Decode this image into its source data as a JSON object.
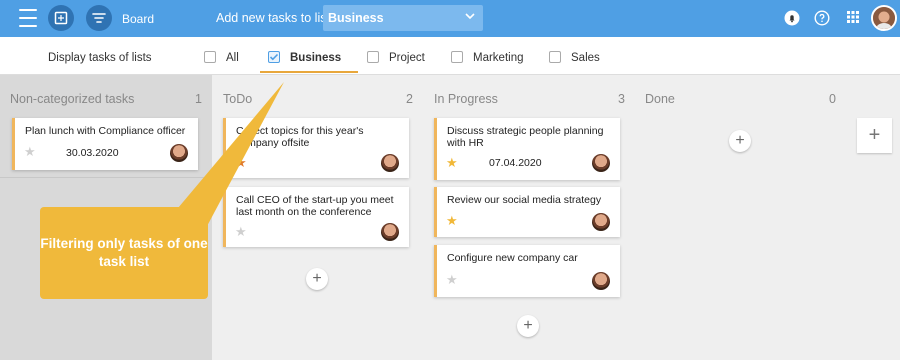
{
  "header": {
    "board_label": "Board",
    "add_label": "Add new tasks to list",
    "list_select_value": "Business"
  },
  "filter": {
    "label": "Display tasks of lists",
    "options": [
      {
        "label": "All",
        "checked": false
      },
      {
        "label": "Business",
        "checked": true
      },
      {
        "label": "Project",
        "checked": false
      },
      {
        "label": "Marketing",
        "checked": false
      },
      {
        "label": "Sales",
        "checked": false
      }
    ]
  },
  "columns": [
    {
      "name": "Non-categorized tasks",
      "count": "1"
    },
    {
      "name": "ToDo",
      "count": "2"
    },
    {
      "name": "In Progress",
      "count": "3"
    },
    {
      "name": "Done",
      "count": "0"
    }
  ],
  "cards": {
    "noncat": [
      {
        "title": "Plan lunch with Compliance officer",
        "date": "30.03.2020"
      }
    ],
    "todo": [
      {
        "title": "Collect topics for this year's company offsite",
        "date": ""
      },
      {
        "title": "Call CEO of the start-up you meet last month on the conference",
        "date": ""
      }
    ],
    "inprogress": [
      {
        "title": "Discuss strategic people planning with HR",
        "date": "07.04.2020"
      },
      {
        "title": "Review our social media strategy",
        "date": ""
      },
      {
        "title": "Configure new company car",
        "date": ""
      }
    ]
  },
  "callout": {
    "text": "Filtering only tasks of one task list"
  },
  "colors": {
    "header": "#4f9fe4",
    "accent": "#f0b65c",
    "callout": "#f0b93b"
  }
}
